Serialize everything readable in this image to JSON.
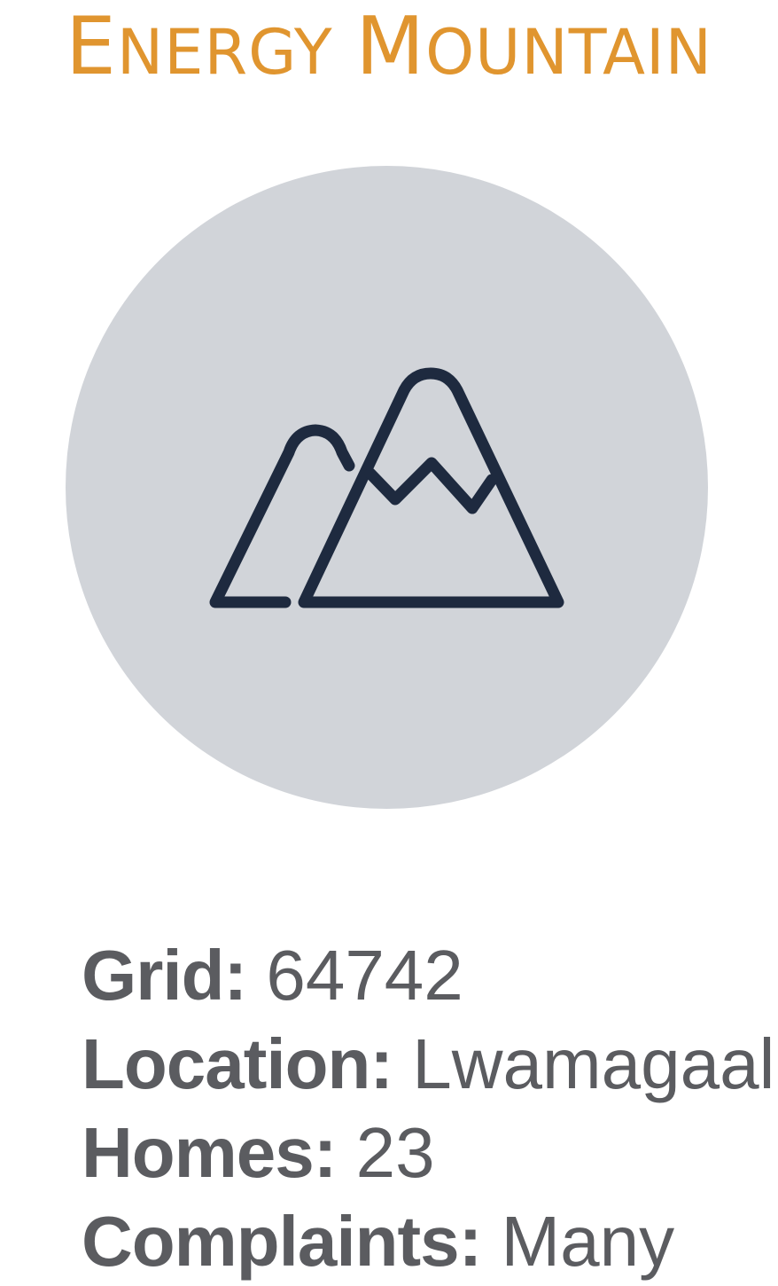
{
  "header": {
    "title_initial_1": "E",
    "title_rest_1": "NERGY",
    "title_initial_2": "M",
    "title_rest_2": "OUNTAIN"
  },
  "icon": {
    "name": "mountain-icon",
    "circle_color": "#d1d4d9",
    "stroke_color": "#1e2a3f"
  },
  "info": {
    "grid_label": "Grid:",
    "grid_value": "64742",
    "location_label": "Location:",
    "location_value": "Lwamagaali",
    "homes_label": "Homes:",
    "homes_value": "23",
    "complaints_label": "Complaints:",
    "complaints_value": "Many"
  },
  "colors": {
    "title": "#e0952f",
    "text": "#5b5c60"
  }
}
